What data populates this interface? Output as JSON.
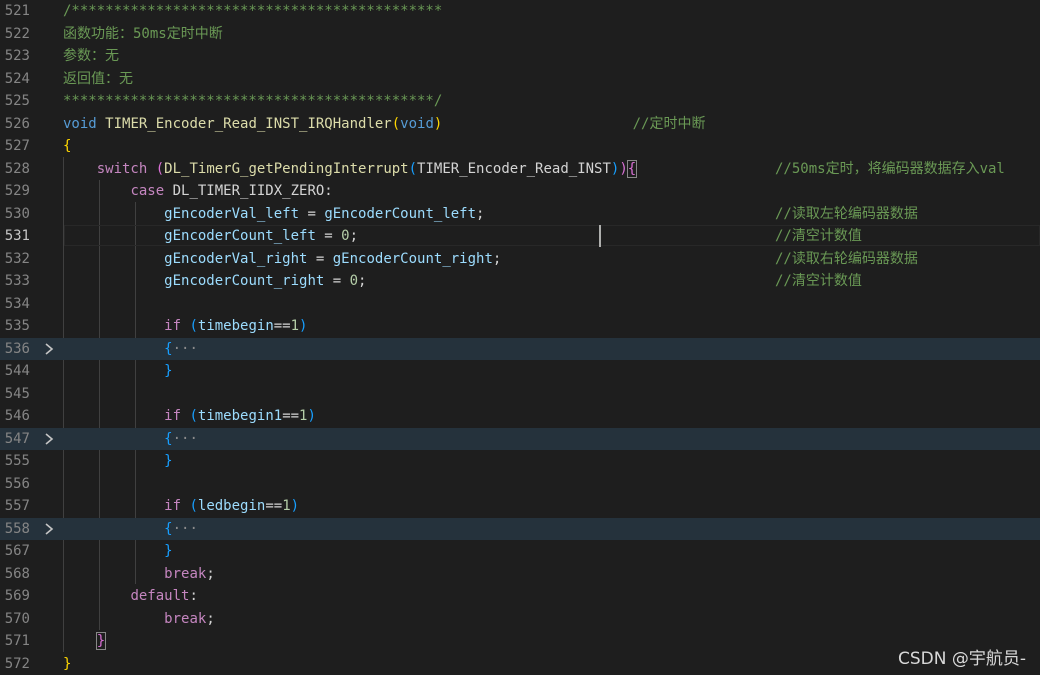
{
  "editor": {
    "lines": [
      {
        "num": "521",
        "tokens": [
          {
            "t": "/********************************************",
            "c": "cmt"
          }
        ]
      },
      {
        "num": "522",
        "tokens": [
          {
            "t": "函数功能：50ms定时中断",
            "c": "cmt"
          }
        ]
      },
      {
        "num": "523",
        "tokens": [
          {
            "t": "参数：无",
            "c": "cmt"
          }
        ]
      },
      {
        "num": "524",
        "tokens": [
          {
            "t": "返回值：无",
            "c": "cmt"
          }
        ]
      },
      {
        "num": "525",
        "tokens": [
          {
            "t": "********************************************/",
            "c": "cmt"
          }
        ]
      },
      {
        "num": "526",
        "tokens": [
          {
            "t": "void",
            "c": "kw"
          },
          {
            "t": " ",
            "c": "txt"
          },
          {
            "t": "TIMER_Encoder_Read_INST_IRQHandler",
            "c": "fn"
          },
          {
            "t": "(",
            "c": "b1"
          },
          {
            "t": "void",
            "c": "kw"
          },
          {
            "t": ")",
            "c": "b1"
          }
        ],
        "comment": "//定时中断",
        "comment_col": 64
      },
      {
        "num": "527",
        "tokens": [
          {
            "t": "{",
            "c": "b1"
          }
        ]
      },
      {
        "num": "528",
        "tokens": [
          {
            "t": "    ",
            "c": "txt"
          },
          {
            "t": "switch",
            "c": "ctl"
          },
          {
            "t": " ",
            "c": "txt"
          },
          {
            "t": "(",
            "c": "b2"
          },
          {
            "t": "DL_TimerG_getPendingInterrupt",
            "c": "fn"
          },
          {
            "t": "(",
            "c": "b3"
          },
          {
            "t": "TIMER_Encoder_Read_INST",
            "c": "txt"
          },
          {
            "t": ")",
            "c": "b3"
          },
          {
            "t": ")",
            "c": "b2"
          },
          {
            "t": "{",
            "c": "b2",
            "box": true
          }
        ],
        "comment": "//50ms定时，将编码器数据存入val",
        "comment_col": 80
      },
      {
        "num": "529",
        "tokens": [
          {
            "t": "        ",
            "c": "txt"
          },
          {
            "t": "case",
            "c": "ctl"
          },
          {
            "t": " DL_TIMER_IIDX_ZERO:",
            "c": "txt"
          }
        ]
      },
      {
        "num": "530",
        "tokens": [
          {
            "t": "            ",
            "c": "txt"
          },
          {
            "t": "gEncoderVal_left",
            "c": "var"
          },
          {
            "t": " = ",
            "c": "txt"
          },
          {
            "t": "gEncoderCount_left",
            "c": "var"
          },
          {
            "t": ";",
            "c": "txt"
          }
        ],
        "comment": "//读取左轮编码器数据",
        "comment_col": 80
      },
      {
        "num": "531",
        "current": true,
        "tokens": [
          {
            "t": "            ",
            "c": "txt"
          },
          {
            "t": "gEncoderCount_left",
            "c": "var"
          },
          {
            "t": " = ",
            "c": "txt"
          },
          {
            "t": "0",
            "c": "num"
          },
          {
            "t": ";",
            "c": "txt"
          }
        ],
        "comment": "//清空计数值",
        "comment_col": 80
      },
      {
        "num": "532",
        "tokens": [
          {
            "t": "            ",
            "c": "txt"
          },
          {
            "t": "gEncoderVal_right",
            "c": "var"
          },
          {
            "t": " = ",
            "c": "txt"
          },
          {
            "t": "gEncoderCount_right",
            "c": "var"
          },
          {
            "t": ";",
            "c": "txt"
          }
        ],
        "comment": "//读取右轮编码器数据",
        "comment_col": 80
      },
      {
        "num": "533",
        "tokens": [
          {
            "t": "            ",
            "c": "txt"
          },
          {
            "t": "gEncoderCount_right",
            "c": "var"
          },
          {
            "t": " = ",
            "c": "txt"
          },
          {
            "t": "0",
            "c": "num"
          },
          {
            "t": ";",
            "c": "txt"
          }
        ],
        "comment": "//清空计数值",
        "comment_col": 80
      },
      {
        "num": "534",
        "tokens": []
      },
      {
        "num": "535",
        "tokens": [
          {
            "t": "            ",
            "c": "txt"
          },
          {
            "t": "if",
            "c": "ctl"
          },
          {
            "t": " ",
            "c": "txt"
          },
          {
            "t": "(",
            "c": "b3"
          },
          {
            "t": "timebegin",
            "c": "var"
          },
          {
            "t": "==",
            "c": "txt"
          },
          {
            "t": "1",
            "c": "num"
          },
          {
            "t": ")",
            "c": "b3"
          }
        ]
      },
      {
        "num": "536",
        "folded": true,
        "tokens": [
          {
            "t": "            ",
            "c": "txt"
          },
          {
            "t": "{",
            "c": "b3"
          },
          {
            "t": "···",
            "c": "ell"
          }
        ]
      },
      {
        "num": "544",
        "tokens": [
          {
            "t": "            ",
            "c": "txt"
          },
          {
            "t": "}",
            "c": "b3"
          }
        ]
      },
      {
        "num": "545",
        "tokens": []
      },
      {
        "num": "546",
        "tokens": [
          {
            "t": "            ",
            "c": "txt"
          },
          {
            "t": "if",
            "c": "ctl"
          },
          {
            "t": " ",
            "c": "txt"
          },
          {
            "t": "(",
            "c": "b3"
          },
          {
            "t": "timebegin1",
            "c": "var"
          },
          {
            "t": "==",
            "c": "txt"
          },
          {
            "t": "1",
            "c": "num"
          },
          {
            "t": ")",
            "c": "b3"
          }
        ]
      },
      {
        "num": "547",
        "folded": true,
        "tokens": [
          {
            "t": "            ",
            "c": "txt"
          },
          {
            "t": "{",
            "c": "b3"
          },
          {
            "t": "···",
            "c": "ell"
          }
        ]
      },
      {
        "num": "555",
        "tokens": [
          {
            "t": "            ",
            "c": "txt"
          },
          {
            "t": "}",
            "c": "b3"
          }
        ]
      },
      {
        "num": "556",
        "tokens": []
      },
      {
        "num": "557",
        "tokens": [
          {
            "t": "            ",
            "c": "txt"
          },
          {
            "t": "if",
            "c": "ctl"
          },
          {
            "t": " ",
            "c": "txt"
          },
          {
            "t": "(",
            "c": "b3"
          },
          {
            "t": "ledbegin",
            "c": "var"
          },
          {
            "t": "==",
            "c": "txt"
          },
          {
            "t": "1",
            "c": "num"
          },
          {
            "t": ")",
            "c": "b3"
          }
        ]
      },
      {
        "num": "558",
        "folded": true,
        "tokens": [
          {
            "t": "            ",
            "c": "txt"
          },
          {
            "t": "{",
            "c": "b3"
          },
          {
            "t": "···",
            "c": "ell"
          }
        ]
      },
      {
        "num": "567",
        "tokens": [
          {
            "t": "            ",
            "c": "txt"
          },
          {
            "t": "}",
            "c": "b3"
          }
        ]
      },
      {
        "num": "568",
        "tokens": [
          {
            "t": "            ",
            "c": "txt"
          },
          {
            "t": "break",
            "c": "ctl"
          },
          {
            "t": ";",
            "c": "txt"
          }
        ]
      },
      {
        "num": "569",
        "tokens": [
          {
            "t": "        ",
            "c": "txt"
          },
          {
            "t": "default",
            "c": "ctl"
          },
          {
            "t": ":",
            "c": "txt"
          }
        ]
      },
      {
        "num": "570",
        "tokens": [
          {
            "t": "            ",
            "c": "txt"
          },
          {
            "t": "break",
            "c": "ctl"
          },
          {
            "t": ";",
            "c": "txt"
          }
        ]
      },
      {
        "num": "571",
        "tokens": [
          {
            "t": "    ",
            "c": "txt"
          },
          {
            "t": "}",
            "c": "b2",
            "box": true
          }
        ]
      },
      {
        "num": "572",
        "tokens": [
          {
            "t": "}",
            "c": "b1"
          }
        ]
      }
    ]
  },
  "watermark": "CSDN @宇航员-"
}
